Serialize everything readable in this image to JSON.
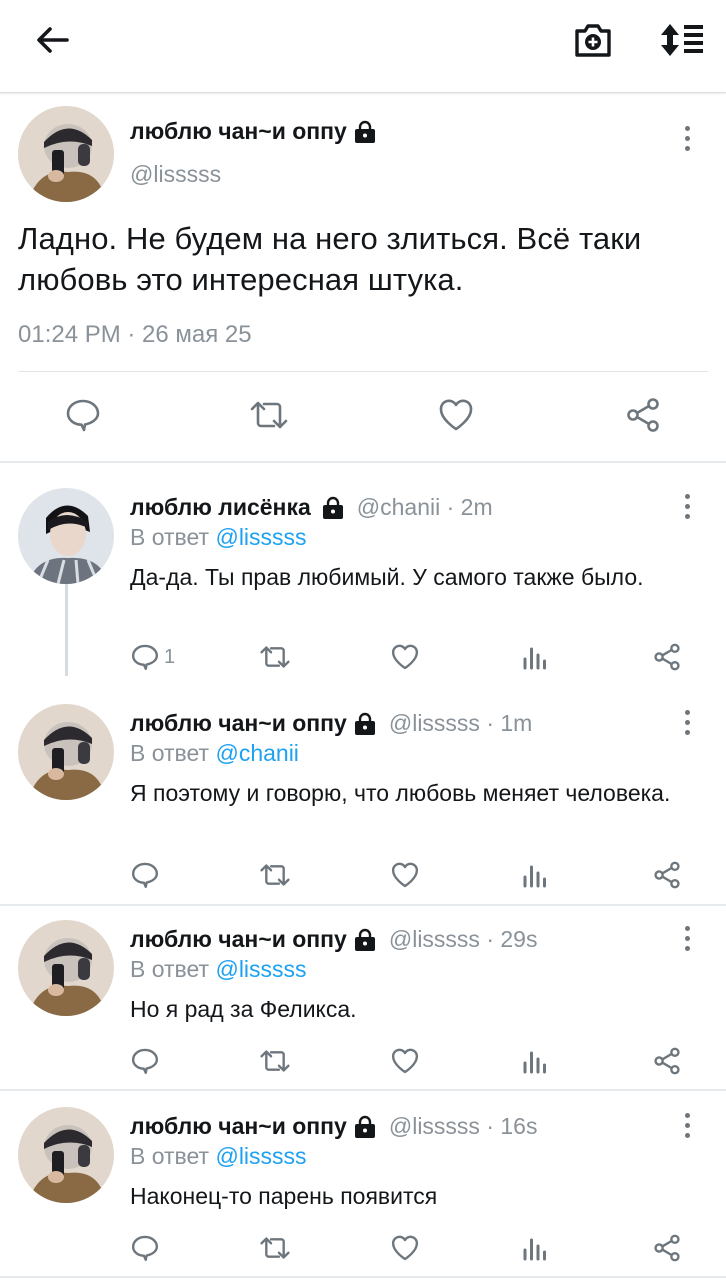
{
  "topbar": {
    "back_icon": "arrow-left-icon",
    "camera_icon": "camera-plus-icon",
    "sort_icon": "sort-list-icon"
  },
  "main_tweet": {
    "name": "люблю чан~и оппу",
    "handle": "@lisssss",
    "text": "Ладно. Не будем на него злиться. Всё таки любовь это интересная штука.",
    "timestamp": "01:24 PM · 26 мая 25"
  },
  "replies": [
    {
      "name": "люблю лисёнка",
      "handle_time": "@chanii · 2m",
      "reply_prefix": "В ответ ",
      "reply_to": "@lisssss",
      "text": "Да-да. Ты прав любимый. У самого также было.",
      "reply_count": "1"
    },
    {
      "name": "люблю чан~и оппу",
      "handle_time": "@lisssss · 1m",
      "reply_prefix": "В ответ ",
      "reply_to": "@chanii",
      "text": "Я поэтому и говорю, что любовь меняет человека.",
      "reply_count": ""
    },
    {
      "name": "люблю чан~и оппу",
      "handle_time": "@lisssss · 29s",
      "reply_prefix": "В ответ ",
      "reply_to": "@lisssss",
      "text": "Но я рад за Феликса.",
      "reply_count": ""
    },
    {
      "name": "люблю чан~и оппу",
      "handle_time": "@lisssss · 16s",
      "reply_prefix": "В ответ ",
      "reply_to": "@lisssss",
      "text": "Наконец-то парень появится",
      "reply_count": ""
    }
  ],
  "colors": {
    "accent": "#1da1f2",
    "muted": "#8a9299",
    "icon": "#6e767d"
  }
}
